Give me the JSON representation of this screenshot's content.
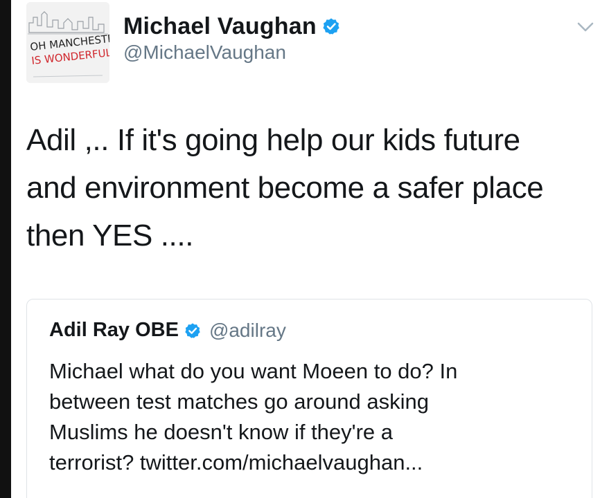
{
  "author": {
    "display_name": "Michael Vaughan",
    "handle": "@MichaelVaughan",
    "avatar_text_line1": "OH MANCHESTER",
    "avatar_text_line2": "IS WONDERFUL"
  },
  "tweet": {
    "lines": [
      "Adil ,.. If it's going help our kids future",
      "and environment become a safer place",
      "then YES ...."
    ]
  },
  "quoted_tweet": {
    "display_name": "Adil Ray OBE",
    "handle": "@adilray",
    "lines": [
      "Michael what do you want Moeen to do? In",
      "between test matches go around asking",
      "Muslims he doesn't know if they're a",
      "terrorist? twitter.com/michaelvaughan..."
    ]
  },
  "colors": {
    "verified_blue": "#1da1f2",
    "text_primary": "#14171a",
    "text_secondary": "#657786",
    "avatar_red": "#d0262c"
  },
  "icons": {
    "verified": "verified-badge-icon",
    "menu": "chevron-down-icon"
  }
}
